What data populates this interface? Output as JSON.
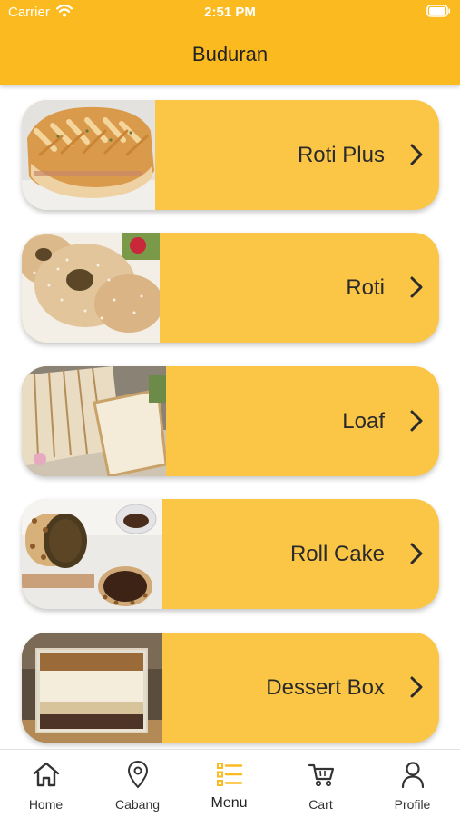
{
  "status_bar": {
    "carrier": "Carrier",
    "time": "2:51 PM"
  },
  "header": {
    "title": "Buduran"
  },
  "colors": {
    "header": "#fbbb20",
    "card": "#fbc646",
    "active_icon": "#fbbb20"
  },
  "categories": [
    {
      "label": "Roti Plus",
      "image": "braided-bread-photo"
    },
    {
      "label": "Roti",
      "image": "sesame-bun-photo"
    },
    {
      "label": "Loaf",
      "image": "sliced-loaf-photo"
    },
    {
      "label": "Roll Cake",
      "image": "roll-cake-photo"
    },
    {
      "label": "Dessert Box",
      "image": "dessert-box-photo"
    }
  ],
  "nav": [
    {
      "label": "Home",
      "icon": "home-icon"
    },
    {
      "label": "Cabang",
      "icon": "location-pin-icon"
    },
    {
      "label": "Menu",
      "icon": "list-icon",
      "active": true
    },
    {
      "label": "Cart",
      "icon": "cart-icon"
    },
    {
      "label": "Profile",
      "icon": "person-icon"
    }
  ]
}
